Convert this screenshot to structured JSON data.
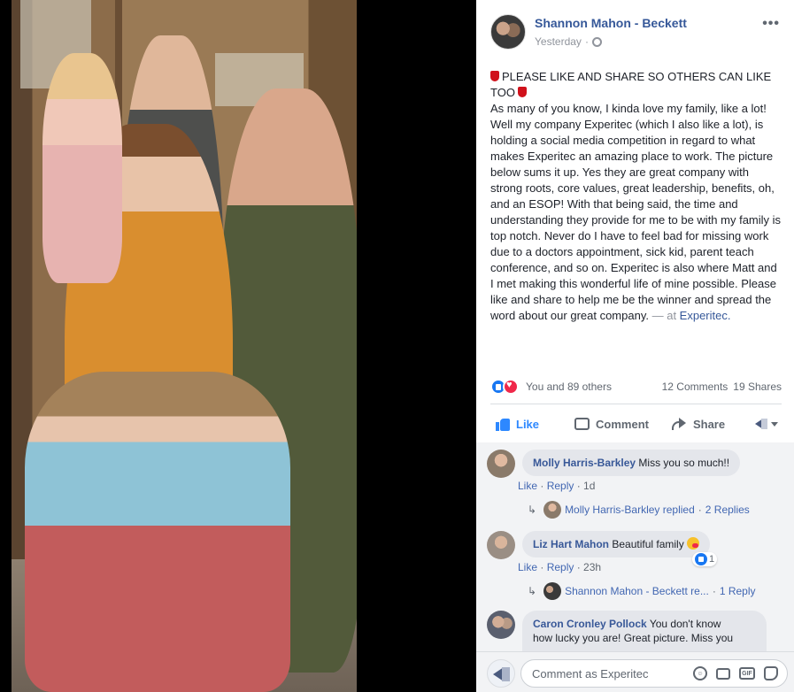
{
  "post": {
    "author": "Shannon Mahon - Beckett",
    "timestamp": "Yesterday",
    "privacy_icon": "globe-icon",
    "more_label": "•••",
    "headline": "PLEASE LIKE AND SHARE SO OTHERS CAN LIKE TOO",
    "body": "As many of you know, I kinda love my family, like a lot! Well my company Experitec (which I also like a lot), is holding a social media competition in regard to what makes Experitec an amazing place to work. The picture below sums it up. Yes they are great company with strong roots, core values, great leadership, benefits, oh, and an ESOP! With that being said, the time and understanding they provide for me to be with my family is top notch. Never do I have to feel bad for missing work due to a doctors appointment, sick kid, parent teach conference, and so on. Experitec is also where Matt and I met making this wonderful life of mine possible. Please like and share to help me be the winner and spread the word about our great company.",
    "at_prefix": " — at ",
    "location": "Experitec."
  },
  "stats": {
    "reactions_text": "You and 89 others",
    "comments": "12 Comments",
    "shares": "19 Shares"
  },
  "actions": {
    "like": "Like",
    "comment": "Comment",
    "share": "Share"
  },
  "comments": [
    {
      "name": "Molly Harris-Barkley",
      "text": "Miss you so much!!",
      "like": "Like",
      "reply": "Reply",
      "age": "1d",
      "replied_by": "Molly Harris-Barkley replied",
      "replies": "2 Replies"
    },
    {
      "name": "Liz Hart Mahon",
      "text": "Beautiful family",
      "like": "Like",
      "reply": "Reply",
      "age": "23h",
      "reaction_count": "1",
      "replied_by": "Shannon Mahon - Beckett re...",
      "replies": "1 Reply"
    },
    {
      "name": "Caron Cronley Pollock",
      "text_line1": "You don't know",
      "text_line2": "how lucky you are! Great picture. Miss you"
    }
  ],
  "composer": {
    "placeholder": "Comment as Experitec",
    "gif_label": "GIF"
  },
  "colors": {
    "link": "#365899",
    "like_blue": "#2d88ff",
    "love_red": "#f0284a",
    "muted": "#90949c"
  }
}
